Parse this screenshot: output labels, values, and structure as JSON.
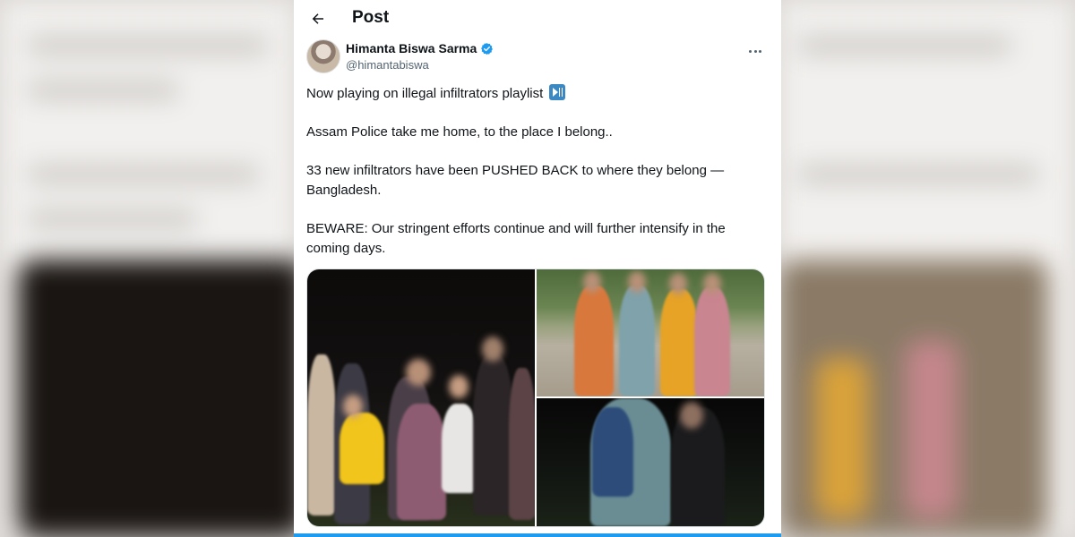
{
  "header": {
    "title": "Post",
    "back_icon": "arrow-left-icon"
  },
  "author": {
    "display_name": "Himanta Biswa Sarma",
    "handle": "@himantabiswa",
    "verified_icon": "verified-badge-icon",
    "verified_color": "#1d9bf0",
    "more_icon": "more-horizontal-icon"
  },
  "post": {
    "paragraphs": [
      "Now playing on illegal infiltrators playlist",
      "Assam Police take me home, to the place I belong..",
      "33 new infiltrators have been PUSHED BACK  to where they belong — Bangladesh.",
      "BEWARE: Our stringent efforts continue and will further intensify in the coming days."
    ],
    "inline_emoji_icon": "play-pause-button-icon"
  },
  "media": [
    {
      "description_icon": "photo-night-group"
    },
    {
      "description_icon": "photo-day-group"
    },
    {
      "description_icon": "photo-night-child"
    }
  ],
  "colors": {
    "accent": "#1d9bf0",
    "text": "#0f1419",
    "secondary_text": "#536471"
  }
}
